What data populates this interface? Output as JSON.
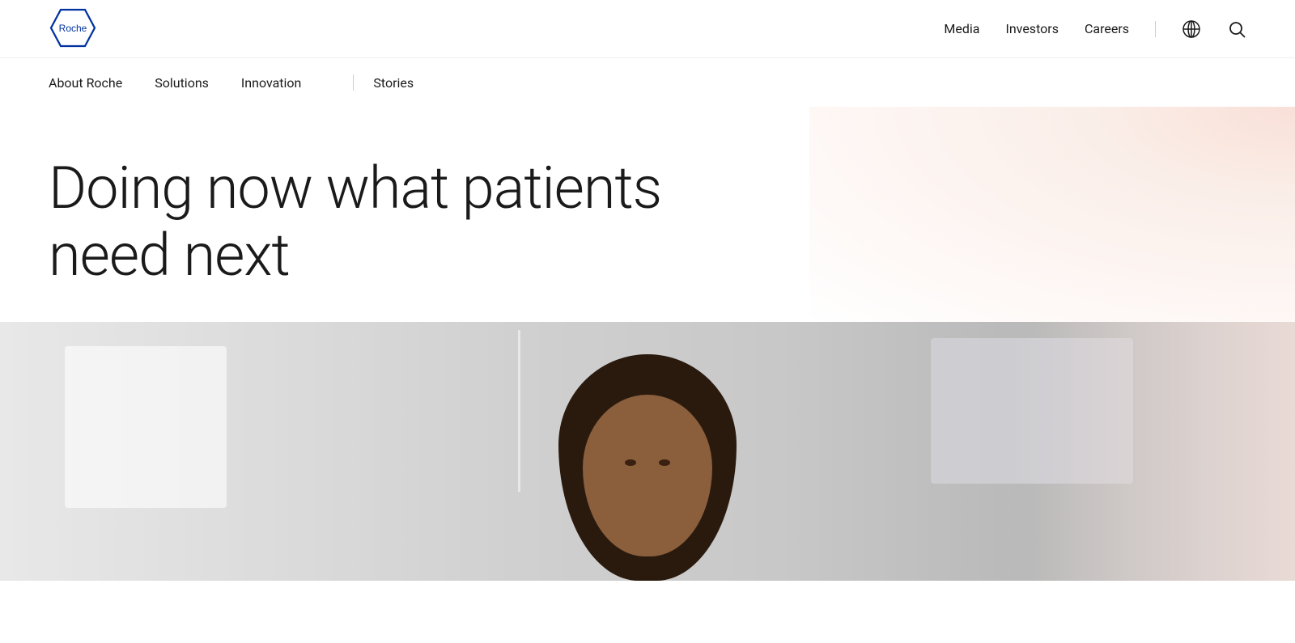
{
  "brand": {
    "name": "Roche",
    "logo_text": "Roche"
  },
  "top_nav": {
    "links": [
      {
        "id": "media",
        "label": "Media"
      },
      {
        "id": "investors",
        "label": "Investors"
      },
      {
        "id": "careers",
        "label": "Careers"
      }
    ],
    "icons": {
      "globe": "🌐",
      "search": "🔍"
    }
  },
  "main_nav": {
    "links": [
      {
        "id": "about",
        "label": "About Roche"
      },
      {
        "id": "solutions",
        "label": "Solutions"
      },
      {
        "id": "innovation",
        "label": "Innovation"
      },
      {
        "id": "stories",
        "label": "Stories"
      }
    ]
  },
  "hero": {
    "title_line1": "Doing now what patients",
    "title_line2": "need next"
  },
  "colors": {
    "brand_blue": "#0033a0",
    "background": "#ffffff",
    "text_dark": "#1a1a1a",
    "gradient_pink": "#f9e0d8"
  }
}
